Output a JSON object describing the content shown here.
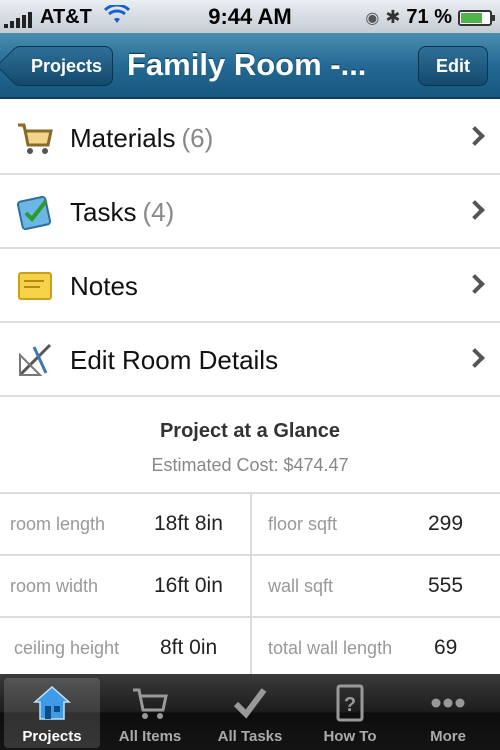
{
  "status_bar": {
    "carrier": "AT&T",
    "time": "9:44 AM",
    "battery": "71 %",
    "battery_level": 0.71
  },
  "nav": {
    "back_label": "Projects",
    "title": "Family Room -...",
    "edit_label": "Edit"
  },
  "menu": {
    "items": [
      {
        "label": "Materials",
        "count": "(6)",
        "icon": "cart-icon"
      },
      {
        "label": "Tasks",
        "count": "(4)",
        "icon": "checklist-icon"
      },
      {
        "label": "Notes",
        "count": "",
        "icon": "sticky-note-icon"
      },
      {
        "label": "Edit Room Details",
        "count": "",
        "icon": "ruler-icon"
      }
    ]
  },
  "glance": {
    "title": "Project at a Glance",
    "cost": "Estimated Cost: $474.47"
  },
  "stats": [
    {
      "label": "room length",
      "value": "18ft 8in"
    },
    {
      "label": "floor sqft",
      "value": "299"
    },
    {
      "label": "room width",
      "value": "16ft 0in"
    },
    {
      "label": "wall sqft",
      "value": "555"
    },
    {
      "label": "ceiling height",
      "value": "8ft 0in"
    },
    {
      "label": "total wall length",
      "value": "69"
    }
  ],
  "tabs": [
    {
      "label": "Projects",
      "icon": "house-icon",
      "active": true
    },
    {
      "label": "All Items",
      "icon": "cart-icon",
      "active": false
    },
    {
      "label": "All Tasks",
      "icon": "checkmark-icon",
      "active": false
    },
    {
      "label": "How To",
      "icon": "help-book-icon",
      "active": false
    },
    {
      "label": "More",
      "icon": "more-icon",
      "active": false
    }
  ],
  "colors": {
    "nav_blue": "#246a94",
    "tab_bar": "#1c1c1c",
    "battery_green": "#4fb34a"
  }
}
